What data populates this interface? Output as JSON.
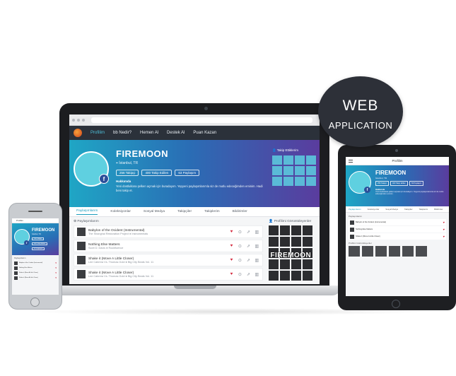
{
  "badge": {
    "line1": "WEB",
    "line2": "APPLICATION"
  },
  "nav": {
    "items": [
      {
        "label": "Profilim",
        "active": true
      },
      {
        "label": "bb Nedir?",
        "active": false
      },
      {
        "label": "Hemen Al",
        "active": false
      },
      {
        "label": "Destek Al",
        "active": false
      },
      {
        "label": "Puan Kazan",
        "active": false
      }
    ]
  },
  "profile": {
    "name": "FIREMOON",
    "location": "İstanbul, TR",
    "stats": [
      "256 Takipçi",
      "400 Takip Edilen",
      "63 Paylaşım"
    ],
    "about_title": "Hakkımda",
    "about_text": "Yeni dostluklara şelken açmak için buradayım. Yepyeni paylaşımlarımla siz de mutlu edeceğimden eminim. Hadi beni takip et.",
    "followers_title": "Takip Ettiklerim",
    "facebook_icon": "f"
  },
  "tabs": [
    "Paylaşımlarım",
    "Koleksiyonlar",
    "Sosyal Medya",
    "Takipçiler",
    "Takiplerim",
    "Bildirimler"
  ],
  "shares": {
    "title": "Paylaşımlarım",
    "tracks": [
      {
        "title": "Babylon of the Ocident (Instrumental)",
        "sub": "The Shanghai Restoration Project ● Instrumentals"
      },
      {
        "title": "Nothing Else Matters",
        "sub": "Scott D. Davis ● Rockfluence"
      },
      {
        "title": "Shake it (Move A Little Closer)",
        "sub": "Lee Cabrera Vs. Thomas Gold ● Big City Beats Vol. 11"
      },
      {
        "title": "Shake it (Move A Little Closer)",
        "sub": "Lee Cabrera Vs. Thomas Gold ● Big City Beats Vol. 11"
      }
    ]
  },
  "visitors": {
    "title": "Profilimi Görüntüleyenler",
    "overlay": "FIREMOON"
  },
  "tablet": {
    "title": "Profilim",
    "name": "FIREMOON",
    "location": "İstanbul, TR",
    "stats": [
      "256 Takipçi",
      "400 Takip Edilen",
      "63 Paylaşım"
    ],
    "about_title": "Hakkımda",
    "about_text": "Yeni dostluklara şelken açmak için buradayım. Yepyeni paylaşımlarımla siz de mutlu edeceğimden eminim.",
    "tabs": [
      "Paylaşımlarım",
      "Koleksiyonlar",
      "Sosyal Medya",
      "Takipçiler",
      "Takiplerim",
      "Bildirimler"
    ],
    "shares_title": "Paylaşımlarım",
    "tracks": [
      "Babylon of the Ocident (Instrumental)",
      "Nothing Else Matters",
      "Shake it (Move A Little Closer)"
    ],
    "visitors_title": "Profilimi Görüntüleyenler"
  },
  "phone": {
    "title": "Profilim",
    "name": "FIREMOON",
    "location": "İstanbul, TR",
    "stats": [
      "256 Takipçi",
      "400 Takip Edilen",
      "63 Paylaşım"
    ],
    "shares_title": "Paylaşımlarım",
    "tracks": [
      "Babylon of the Ocident (Instrumental)",
      "Nothing Else Matters",
      "Shake it (Move A Little Closer)",
      "Shake it (Move A Little Closer)"
    ]
  },
  "colors": {
    "accent": "#1c9dbd",
    "heart": "#d3243a",
    "nav_bg": "#2b313a",
    "badge_bg": "#2d3038"
  }
}
